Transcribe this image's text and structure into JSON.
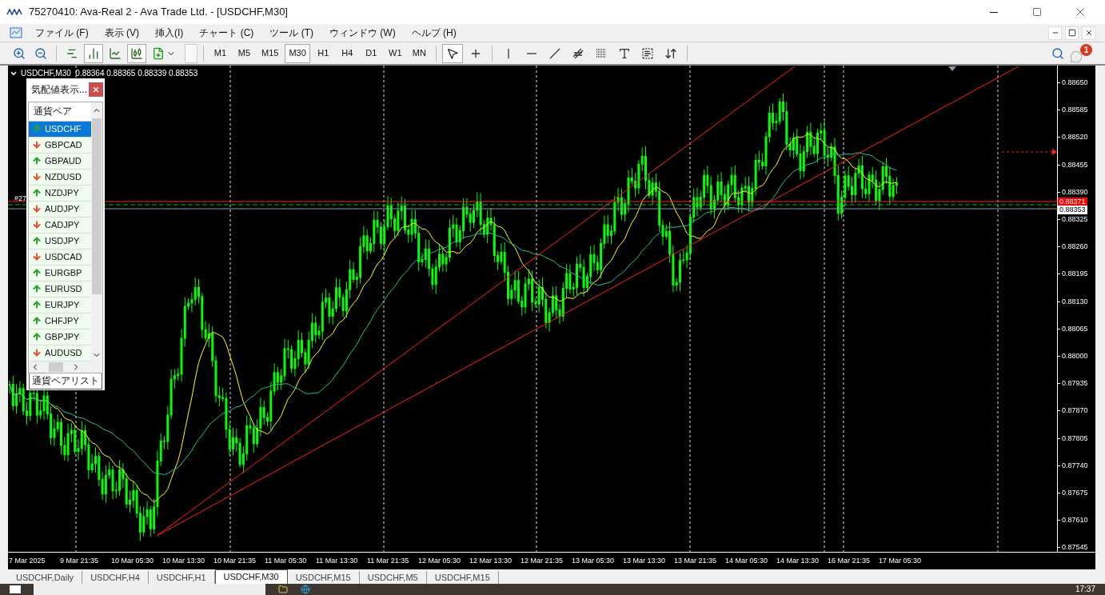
{
  "window": {
    "title": "75270410: Ava-Real 2 - Ava Trade Ltd. - [USDCHF,M30]"
  },
  "menu": [
    "ファイル (F)",
    "表示 (V)",
    "挿入(I)",
    "チャート (C)",
    "ツール (T)",
    "ウィンドウ (W)",
    "ヘルプ (H)"
  ],
  "chart_toggles": [
    {
      "kind": "shift",
      "selected": false
    },
    {
      "kind": "autoscroll",
      "selected": true
    },
    {
      "kind": "line",
      "selected": false
    },
    {
      "kind": "candle",
      "selected": true
    }
  ],
  "periods": [
    {
      "label": "M1",
      "selected": false
    },
    {
      "label": "M5",
      "selected": false
    },
    {
      "label": "M15",
      "selected": false
    },
    {
      "label": "M30",
      "selected": true
    },
    {
      "label": "H1",
      "selected": false
    },
    {
      "label": "H4",
      "selected": false
    },
    {
      "label": "D1",
      "selected": false
    },
    {
      "label": "W1",
      "selected": false
    },
    {
      "label": "MN",
      "selected": false
    }
  ],
  "tools": [
    {
      "kind": "cursor",
      "selected": true
    },
    {
      "kind": "crosshair",
      "selected": false
    },
    {
      "kind": "vline",
      "selected": false
    },
    {
      "kind": "hline",
      "selected": false
    },
    {
      "kind": "trend",
      "selected": false
    },
    {
      "kind": "channel",
      "selected": false
    },
    {
      "kind": "fibo",
      "selected": false
    },
    {
      "kind": "text",
      "selected": false
    },
    {
      "kind": "label",
      "selected": false
    },
    {
      "kind": "arrows",
      "selected": false
    }
  ],
  "notifications": {
    "count": "1"
  },
  "chart": {
    "header": "USDCHF,M30  0.88364 0.88365 0.88339 0.88353",
    "order_label": "#27",
    "price_axis": [
      "0.88650",
      "0.88585",
      "0.88520",
      "0.88455",
      "0.88390",
      "0.88325",
      "0.88260",
      "0.88195",
      "0.88130",
      "0.88065",
      "0.88000",
      "0.87935",
      "0.87870",
      "0.87805",
      "0.87740",
      "0.87675",
      "0.87610",
      "0.87545"
    ],
    "order_price": "0.88371",
    "bid_price": "0.88353",
    "time_axis": [
      "7 Mar 2025",
      "9 Mar 21:35",
      "10 Mar 05:30",
      "10 Mar 13:30",
      "10 Mar 21:35",
      "11 Mar 05:30",
      "11 Mar 13:30",
      "11 Mar 21:35",
      "12 Mar 05:30",
      "12 Mar 13:30",
      "12 Mar 21:35",
      "13 Mar 05:30",
      "13 Mar 13:30",
      "13 Mar 21:35",
      "14 Mar 05:30",
      "14 Mar 13:30",
      "16 Mar 21:35",
      "17 Mar 05:30"
    ]
  },
  "market_watch": {
    "title": "気配値表示...",
    "column": "通貨ペア",
    "tab": "通貨ペアリスト",
    "items": [
      {
        "symbol": "USDCHF",
        "kind": "up",
        "selected": true
      },
      {
        "symbol": "GBPCAD",
        "kind": "down",
        "selected": false
      },
      {
        "symbol": "GBPAUD",
        "kind": "up",
        "selected": false
      },
      {
        "symbol": "NZDUSD",
        "kind": "down",
        "selected": false
      },
      {
        "symbol": "NZDJPY",
        "kind": "up",
        "selected": false
      },
      {
        "symbol": "AUDJPY",
        "kind": "down",
        "selected": false
      },
      {
        "symbol": "CADJPY",
        "kind": "down",
        "selected": false
      },
      {
        "symbol": "USDJPY",
        "kind": "up",
        "selected": false
      },
      {
        "symbol": "USDCAD",
        "kind": "down",
        "selected": false
      },
      {
        "symbol": "EURGBP",
        "kind": "up",
        "selected": false
      },
      {
        "symbol": "EURUSD",
        "kind": "up",
        "selected": false
      },
      {
        "symbol": "EURJPY",
        "kind": "up",
        "selected": false
      },
      {
        "symbol": "CHFJPY",
        "kind": "up",
        "selected": false
      },
      {
        "symbol": "GBPJPY",
        "kind": "up",
        "selected": false
      },
      {
        "symbol": "AUDUSD",
        "kind": "down",
        "selected": false
      }
    ]
  },
  "chart_tabs": [
    {
      "label": "USDCHF,Daily",
      "selected": false
    },
    {
      "label": "USDCHF,H4",
      "selected": false
    },
    {
      "label": "USDCHF,H1",
      "selected": false
    },
    {
      "label": "USDCHF,M30",
      "selected": true
    },
    {
      "label": "USDCHF,M15",
      "selected": false
    },
    {
      "label": "USDCHF,M5",
      "selected": false
    },
    {
      "label": "USDCHF,M15",
      "selected": false
    }
  ],
  "taskbar": {
    "time": "17:37"
  }
}
